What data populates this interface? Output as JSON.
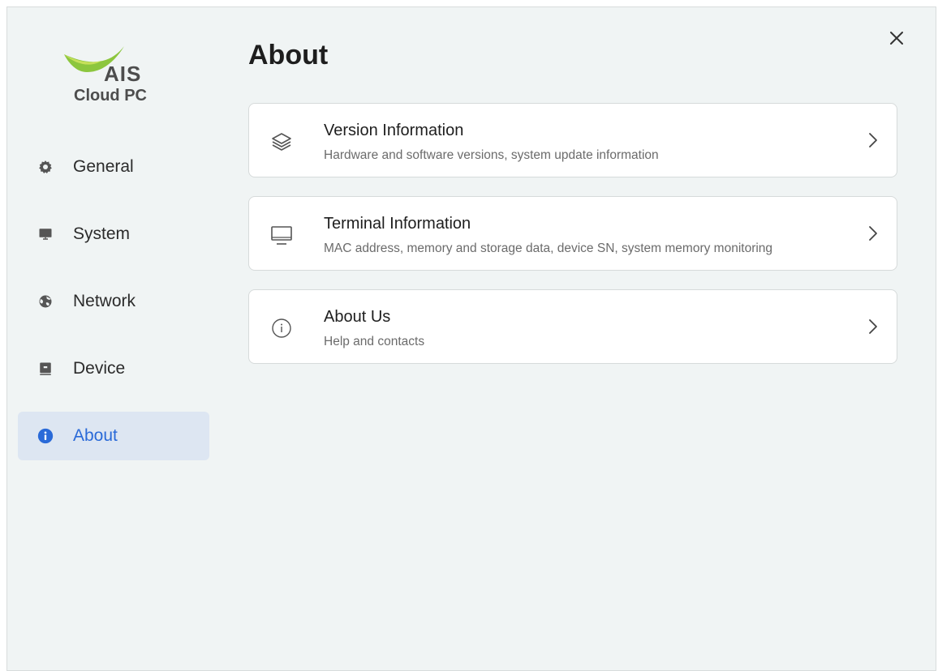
{
  "app": {
    "logo_brand": "AIS",
    "logo_product": "Cloud PC",
    "brand_colors": {
      "swoosh_green": "#8cc63e",
      "swoosh_light": "#c6e05a",
      "active": "#2a6ad8"
    }
  },
  "sidebar": {
    "items": [
      {
        "label": "General",
        "icon": "gear-icon",
        "active": false
      },
      {
        "label": "System",
        "icon": "monitor-icon",
        "active": false
      },
      {
        "label": "Network",
        "icon": "globe-icon",
        "active": false
      },
      {
        "label": "Device",
        "icon": "device-icon",
        "active": false
      },
      {
        "label": "About",
        "icon": "info-icon",
        "active": true
      }
    ]
  },
  "main": {
    "title": "About",
    "cards": [
      {
        "title": "Version Information",
        "subtitle": "Hardware and software versions, system update information",
        "icon": "layers-icon"
      },
      {
        "title": "Terminal Information",
        "subtitle": "MAC address, memory and storage data, device SN, system memory monitoring",
        "icon": "monitor-icon"
      },
      {
        "title": "About Us",
        "subtitle": "Help and contacts",
        "icon": "info-circle-icon"
      }
    ]
  },
  "window": {
    "close_icon": "close-icon"
  }
}
